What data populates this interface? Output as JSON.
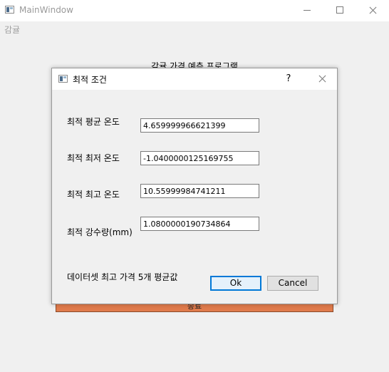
{
  "main_window": {
    "title": "MainWindow",
    "menu_item": "감귤",
    "heading": "감귤 가격 예측 프로그램",
    "bottom_button_label": "종료"
  },
  "dialog": {
    "title": "최적 조건",
    "help_label": "?",
    "fields": [
      {
        "label": "최적 평균 온도",
        "value": "4.659999966621399"
      },
      {
        "label": "최적 최저 온도",
        "value": "-1.0400000125169755"
      },
      {
        "label": "최적 최고 온도",
        "value": "10.55999984741211"
      },
      {
        "label": "최적 강수량(mm)",
        "value": "1.0800000190734864"
      }
    ],
    "footer_note": "데이터셋 최고 가격 5개 평균값",
    "ok_label": "Ok",
    "cancel_label": "Cancel"
  },
  "icons": {
    "app": "app-window-icon",
    "minimize": "minimize-icon",
    "maximize": "maximize-icon",
    "close": "close-icon"
  },
  "colors": {
    "bottom_button": "#e07b4c",
    "ok_border": "#0078d7",
    "window_background": "#f0f0f0"
  }
}
